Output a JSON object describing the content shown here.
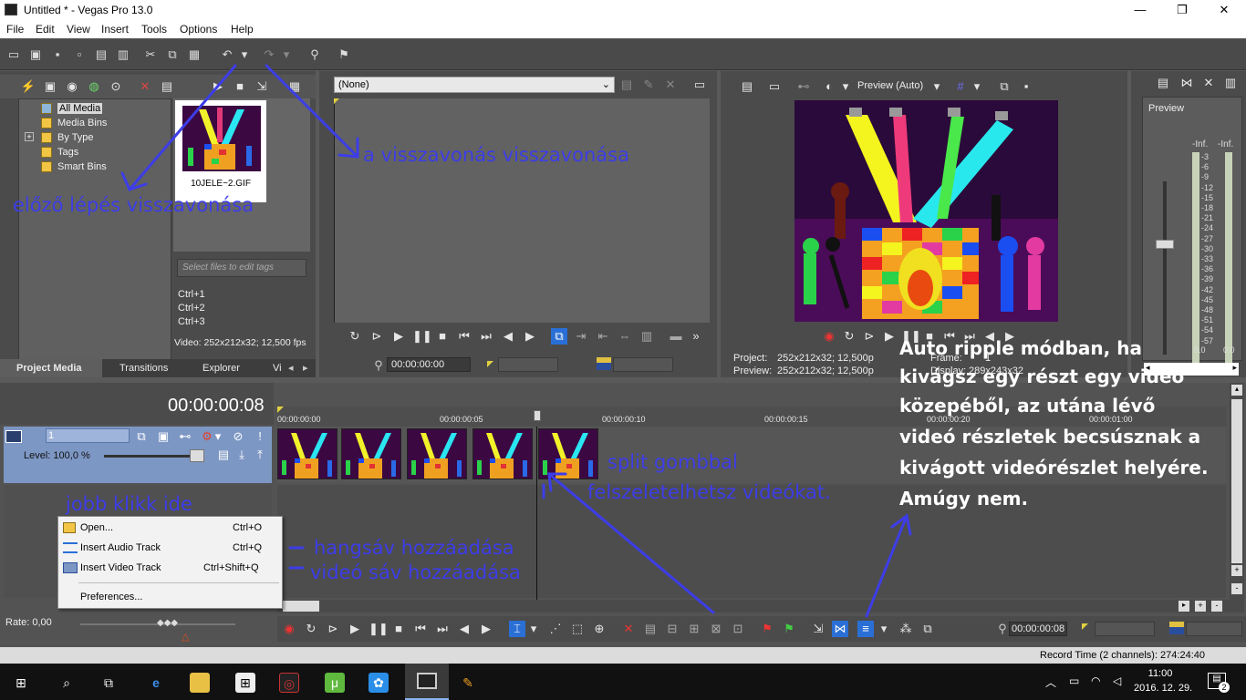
{
  "window": {
    "title": "Untitled * - Vegas Pro 13.0",
    "minimize": "—",
    "maximize": "❐",
    "close": "✕"
  },
  "menu": [
    "File",
    "Edit",
    "View",
    "Insert",
    "Tools",
    "Options",
    "Help"
  ],
  "project_media": {
    "tree": [
      "All Media",
      "Media Bins",
      "By Type",
      "Tags",
      "Smart Bins"
    ],
    "expander": "+",
    "media_file": "10JELE~2.GIF",
    "tags_placeholder": "Select files to edit tags",
    "shortcuts": [
      "Ctrl+1",
      "Ctrl+2",
      "Ctrl+3"
    ],
    "video_info": "Video: 252x212x32; 12,500 fps",
    "tabs": [
      "Project Media",
      "Transitions",
      "Explorer",
      "Vi"
    ]
  },
  "trimmer": {
    "dropdown_value": "(None)",
    "timecode": "00:00:00:00"
  },
  "preview": {
    "mode": "Preview (Auto)",
    "project_label": "Project:",
    "project_value": "252x212x32; 12,500p",
    "preview_label": "Preview:",
    "preview_value": "252x212x32; 12,500p",
    "frame_label": "Frame:",
    "frame_value": "1",
    "display_label": "Display:",
    "display_value": "289x243x32"
  },
  "master": {
    "label": "Preview",
    "left": "-Inf.",
    "right": "-Inf.",
    "scale": [
      "3",
      "6",
      "9",
      "12",
      "15",
      "18",
      "21",
      "24",
      "27",
      "30",
      "33",
      "36",
      "39",
      "42",
      "45",
      "48",
      "51",
      "54",
      "57"
    ],
    "bottom_left": "0.0",
    "bottom_right": "0.0"
  },
  "timeline": {
    "cursor_time": "00:00:00:08",
    "ruler": [
      "00:00:00:00",
      "00:00:00:05",
      "00:00:00:10",
      "00:00:00:15",
      "00:00:00:20",
      "00:00:01:00"
    ],
    "track_number": "1",
    "level": "Level: 100,0 %",
    "rate": "Rate: 0,00",
    "end_timecode": "00:00:00:08",
    "record_time": "Record Time (2 channels): 274:24:40"
  },
  "context_menu": {
    "items": [
      {
        "label": "Open...",
        "shortcut": "Ctrl+O"
      },
      {
        "label": "Insert Audio Track",
        "shortcut": "Ctrl+Q"
      },
      {
        "label": "Insert Video Track",
        "shortcut": "Ctrl+Shift+Q"
      },
      {
        "label": "Preferences...",
        "shortcut": ""
      }
    ]
  },
  "annotations": {
    "undo": "előző lépés visszavonása",
    "redo": "a visszavonás visszavonása",
    "right_click": "jobb klikk ide",
    "audio_track": "hangsáv hozzáadása",
    "video_track": "videó sáv hozzáadása",
    "split1": "split gombbal",
    "split2": "felszeletelhetsz videókat.",
    "ripple": [
      "Auto ripple módban, ha",
      "kivágsz egy részt egy videó",
      "közepéből, az utána lévő",
      "videó részletek becsúsznak a",
      "kivágott videórészlet helyére.",
      "Amúgy nem."
    ]
  },
  "taskbar": {
    "time": "11:00",
    "date": "2016. 12. 29.",
    "notifications": "2"
  },
  "colors": {
    "annotation": "#3d3de8",
    "accent": "#2a6fd6",
    "track_header": "#7d97c4"
  }
}
